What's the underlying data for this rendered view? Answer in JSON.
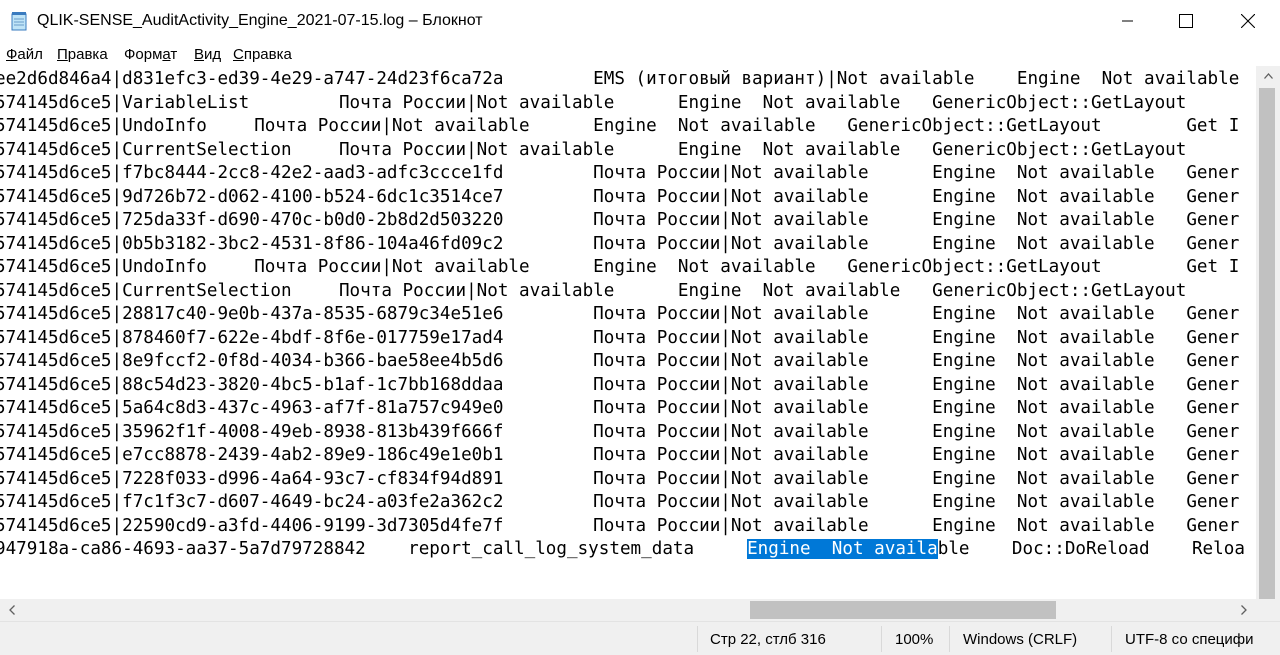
{
  "window": {
    "title": "QLIK-SENSE_AuditActivity_Engine_2021-07-15.log – Блокнот",
    "icon": "notepad-icon"
  },
  "menu": [
    {
      "label": "Файл",
      "accel": "Ф",
      "rest": "айл"
    },
    {
      "label": "Правка",
      "accel": "П",
      "rest": "равка"
    },
    {
      "label": "Формат",
      "pre": "Форм",
      "accel": "а",
      "rest": "т"
    },
    {
      "label": "Вид",
      "accel": "В",
      "rest": "ид"
    },
    {
      "label": "Справка",
      "accel": "С",
      "rest": "правка"
    }
  ],
  "lines": [
    "ee2d6d846a4|d831efc3-ed39-4e29-a747-24d23f6ca72a\tEMS (итоговый вариант)|Not available\tEngine\tNot available",
    "574145d6ce5|VariableList\tПочта России|Not available\tEngine\tNot available\tGenericObject::GetLayout",
    "574145d6ce5|UndoInfo\tПочта России|Not available\tEngine\tNot available\tGenericObject::GetLayout\tGet I",
    "574145d6ce5|CurrentSelection\tПочта России|Not available\tEngine\tNot available\tGenericObject::GetLayout",
    "574145d6ce5|f7bc8444-2cc8-42e2-aad3-adfc3ccce1fd\tПочта России|Not available\tEngine\tNot available\tGener",
    "574145d6ce5|9d726b72-d062-4100-b524-6dc1c3514ce7\tПочта России|Not available\tEngine\tNot available\tGener",
    "574145d6ce5|725da33f-d690-470c-b0d0-2b8d2d503220\tПочта России|Not available\tEngine\tNot available\tGener",
    "574145d6ce5|0b5b3182-3bc2-4531-8f86-104a46fd09c2\tПочта России|Not available\tEngine\tNot available\tGener",
    "574145d6ce5|UndoInfo\tПочта России|Not available\tEngine\tNot available\tGenericObject::GetLayout\tGet I",
    "574145d6ce5|CurrentSelection\tПочта России|Not available\tEngine\tNot available\tGenericObject::GetLayout",
    "574145d6ce5|28817c40-9e0b-437a-8535-6879c34e51e6\tПочта России|Not available\tEngine\tNot available\tGener",
    "574145d6ce5|878460f7-622e-4bdf-8f6e-017759e17ad4\tПочта России|Not available\tEngine\tNot available\tGener",
    "574145d6ce5|8e9fccf2-0f8d-4034-b366-bae58ee4b5d6\tПочта России|Not available\tEngine\tNot available\tGener",
    "574145d6ce5|88c54d23-3820-4bc5-b1af-1c7bb168ddaa\tПочта России|Not available\tEngine\tNot available\tGener",
    "574145d6ce5|5a64c8d3-437c-4963-af7f-81a757c949e0\tПочта России|Not available\tEngine\tNot available\tGener",
    "574145d6ce5|35962f1f-4008-49eb-8938-813b439f666f\tПочта России|Not available\tEngine\tNot available\tGener",
    "574145d6ce5|e7cc8878-2439-4ab2-89e9-186c49e1e0b1\tПочта России|Not available\tEngine\tNot available\tGener",
    "574145d6ce5|7228f033-d996-4a64-93c7-cf834f94d891\tПочта России|Not available\tEngine\tNot available\tGener",
    "574145d6ce5|f7c1f3c7-d607-4649-bc24-a03fe2a362c2\tПочта России|Not available\tEngine\tNot available\tGener",
    "574145d6ce5|22590cd9-a3fd-4406-9199-3d7305d4fe7f\tПочта России|Not available\tEngine\tNot available\tGener"
  ],
  "last_line": {
    "before": "947918a-ca86-4693-aa37-5a7d79728842    report_call_log_system_data     ",
    "selected": "Engine  Not availa",
    "after": "ble    Doc::DoReload    Reloa"
  },
  "status": {
    "position": "Стр 22, стлб 316",
    "zoom": "100%",
    "line_ending": "Windows (CRLF)",
    "encoding": "UTF-8 со специфи"
  },
  "colors": {
    "selection": "#0078d7",
    "chrome": "#f0f0f0"
  }
}
